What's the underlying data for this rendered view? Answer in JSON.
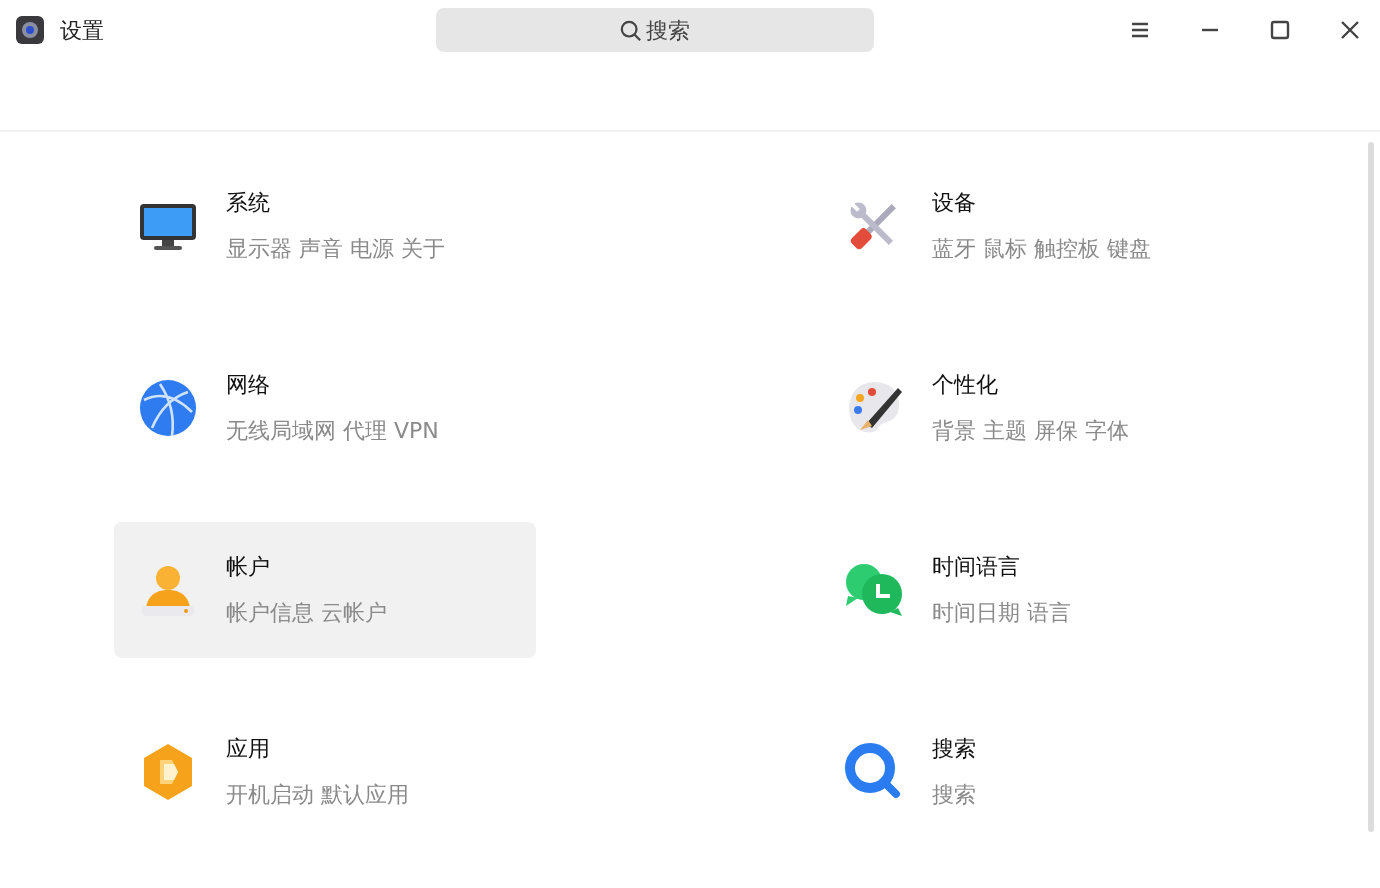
{
  "window": {
    "title": "设置"
  },
  "search": {
    "placeholder": "搜索"
  },
  "categories": [
    {
      "title": "系统",
      "subtitle": "显示器 声音 电源 关于",
      "selected": false
    },
    {
      "title": "设备",
      "subtitle": "蓝牙 鼠标 触控板 键盘",
      "selected": false
    },
    {
      "title": "网络",
      "subtitle": "无线局域网 代理 VPN",
      "selected": false
    },
    {
      "title": "个性化",
      "subtitle": "背景 主题 屏保 字体",
      "selected": false
    },
    {
      "title": "帐户",
      "subtitle": "帐户信息 云帐户",
      "selected": true
    },
    {
      "title": "时间语言",
      "subtitle": "时间日期 语言",
      "selected": false
    },
    {
      "title": "应用",
      "subtitle": "开机启动 默认应用",
      "selected": false
    },
    {
      "title": "搜索",
      "subtitle": "搜索",
      "selected": false
    }
  ]
}
